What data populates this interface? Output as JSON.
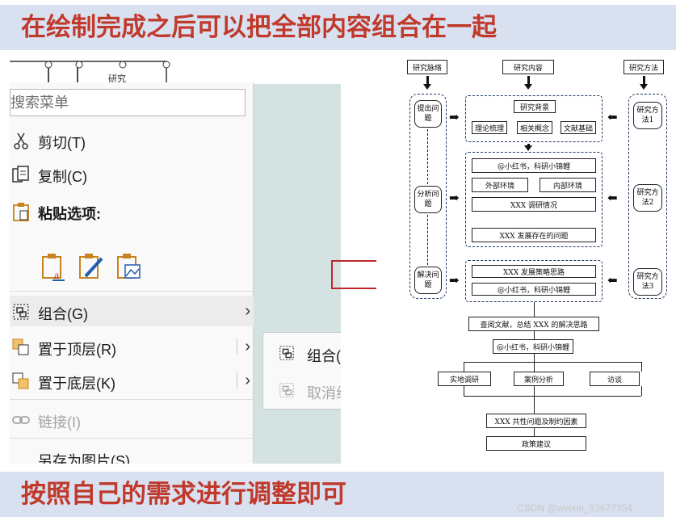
{
  "banner_top": "在绘制完成之后可以把全部内容组合在一起",
  "banner_bottom": "按照自己的需求进行调整即可",
  "shape_strip_text": "研究",
  "menu": {
    "search_placeholder": "搜索菜单",
    "items": [
      {
        "label": "剪切(T)",
        "icon": "scissors-icon"
      },
      {
        "label": "复制(C)",
        "icon": "copy-icon"
      },
      {
        "label": "粘贴选项:",
        "icon": "paste-icon"
      },
      {
        "label": "组合(G)",
        "icon": "group-icon",
        "arrow": "›"
      },
      {
        "label": "置于顶层(R)",
        "icon": "bring-to-front-icon",
        "arrow": "›"
      },
      {
        "label": "置于底层(K)",
        "icon": "send-to-back-icon",
        "arrow": "›"
      },
      {
        "label": "链接(I)",
        "icon": "link-icon",
        "disabled": true
      },
      {
        "label": "另存为图片(S)...",
        "icon": ""
      }
    ],
    "paste_options": [
      "paste-keep-text-icon",
      "paste-format-icon",
      "paste-picture-icon"
    ]
  },
  "submenu": {
    "items": [
      {
        "label": "组合(G)",
        "icon": "group-icon"
      },
      {
        "label": "取消组合",
        "icon": "ungroup-icon",
        "disabled": true
      }
    ]
  },
  "flowchart": {
    "top_labels": [
      "研究脉络",
      "研究内容",
      "研究方法"
    ],
    "left_steps": [
      "提出问题",
      "分析问题",
      "解决问题"
    ],
    "right_methods": [
      "研究方法1",
      "研究方法2",
      "研究方法3"
    ],
    "block1": {
      "title": "研究背景",
      "items": [
        "理论梳理",
        "相关概念",
        "文献基础"
      ]
    },
    "block2": {
      "title": "@小红书，科研小锦鲤",
      "items": [
        "外部环境",
        "内部环境"
      ],
      "status": "XXX 调研情况",
      "issue": "XXX 发展存在的问题"
    },
    "block3": {
      "items": [
        "XXX 发展策略思路",
        "@小红书，科研小锦鲤"
      ]
    },
    "lower": {
      "summary": "查阅文献，总结 XXX 的解决思路",
      "tag": "@小红书，科研小锦鲤",
      "methods": [
        "实地调研",
        "案例分析",
        "访谈"
      ],
      "factors": "XXX 共性问题及制约因素",
      "advice": "政策建议"
    }
  },
  "watermark": "CSDN @weixin_53677354",
  "colors": {
    "banner_bg": "#d9e1f1",
    "banner_text": "#c0392b",
    "accent_red": "#c0272d"
  }
}
